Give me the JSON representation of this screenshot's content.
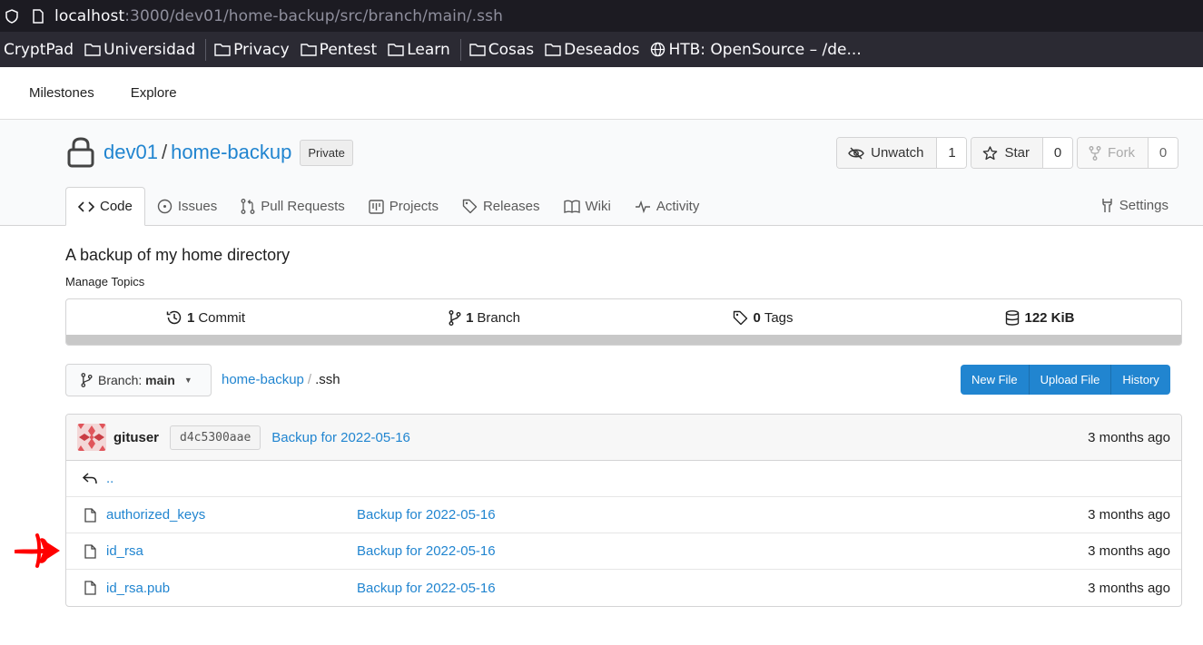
{
  "browser": {
    "url_host": "localhost",
    "url_path": ":3000/dev01/home-backup/src/branch/main/.ssh",
    "bookmarks": [
      {
        "label": "CryptPad",
        "icon": "none"
      },
      {
        "label": "Universidad",
        "icon": "folder-icon"
      },
      {
        "label": "Privacy",
        "icon": "folder-icon"
      },
      {
        "label": "Pentest",
        "icon": "folder-icon"
      },
      {
        "label": "Learn",
        "icon": "folder-icon"
      },
      {
        "label": "Cosas",
        "icon": "folder-icon"
      },
      {
        "label": "Deseados",
        "icon": "folder-icon"
      },
      {
        "label": "HTB: OpenSource – /de...",
        "icon": "globe-icon"
      }
    ]
  },
  "topnav": {
    "milestones": "Milestones",
    "explore": "Explore"
  },
  "repo": {
    "owner": "dev01",
    "slash": "/",
    "name": "home-backup",
    "badge": "Private",
    "unwatch_label": "Unwatch",
    "unwatch_count": "1",
    "star_label": "Star",
    "star_count": "0",
    "fork_label": "Fork",
    "fork_count": "0"
  },
  "tabs": {
    "code": "Code",
    "issues": "Issues",
    "pulls": "Pull Requests",
    "projects": "Projects",
    "releases": "Releases",
    "wiki": "Wiki",
    "activity": "Activity",
    "settings": "Settings"
  },
  "description": "A backup of my home directory",
  "manage_topics": "Manage Topics",
  "stats": {
    "commits_count": "1",
    "commits_label": "Commit",
    "branches_count": "1",
    "branches_label": "Branch",
    "tags_count": "0",
    "tags_label": "Tags",
    "size": "122 KiB"
  },
  "branch": {
    "prefix": "Branch:",
    "name": "main"
  },
  "breadcrumb": {
    "repo": "home-backup",
    "sep": "/",
    "current": ".ssh"
  },
  "actions": {
    "new_file": "New File",
    "upload_file": "Upload File",
    "history": "History"
  },
  "latest_commit": {
    "user": "gituser",
    "sha": "d4c5300aae",
    "message": "Backup for 2022-05-16",
    "age": "3 months ago"
  },
  "parent_dir": "..",
  "files": [
    {
      "name": "authorized_keys",
      "message": "Backup for 2022-05-16",
      "age": "3 months ago"
    },
    {
      "name": "id_rsa",
      "message": "Backup for 2022-05-16",
      "age": "3 months ago"
    },
    {
      "name": "id_rsa.pub",
      "message": "Backup for 2022-05-16",
      "age": "3 months ago"
    }
  ],
  "colors": {
    "link": "#2185d0",
    "primary_button": "#2185d0",
    "annotation_arrow": "#ff0000"
  }
}
